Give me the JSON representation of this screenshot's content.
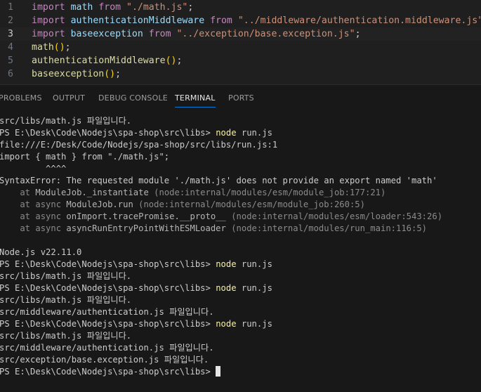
{
  "editor": {
    "lines": [
      {
        "num": "1",
        "parts": [
          {
            "t": "import",
            "c": "kw"
          },
          {
            "t": " ",
            "c": "pun"
          },
          {
            "t": "math",
            "c": "id"
          },
          {
            "t": " ",
            "c": "pun"
          },
          {
            "t": "from",
            "c": "kw"
          },
          {
            "t": " ",
            "c": "pun"
          },
          {
            "t": "\"./math.js\"",
            "c": "str"
          },
          {
            "t": ";",
            "c": "pun"
          }
        ]
      },
      {
        "num": "2",
        "parts": [
          {
            "t": "import",
            "c": "kw"
          },
          {
            "t": " ",
            "c": "pun"
          },
          {
            "t": "authenticationMiddleware",
            "c": "id"
          },
          {
            "t": " ",
            "c": "pun"
          },
          {
            "t": "from",
            "c": "kw"
          },
          {
            "t": " ",
            "c": "pun"
          },
          {
            "t": "\"../middleware/authentication.middleware.js\"",
            "c": "str"
          },
          {
            "t": ";",
            "c": "pun"
          }
        ]
      },
      {
        "num": "3",
        "parts": [
          {
            "t": "import",
            "c": "kw"
          },
          {
            "t": " ",
            "c": "pun"
          },
          {
            "t": "baseexception",
            "c": "id"
          },
          {
            "t": " ",
            "c": "pun"
          },
          {
            "t": "from",
            "c": "kw"
          },
          {
            "t": " ",
            "c": "pun"
          },
          {
            "t": "\"../exception/base.exception.js\"",
            "c": "str"
          },
          {
            "t": ";",
            "c": "pun"
          }
        ]
      },
      {
        "num": "4",
        "parts": [
          {
            "t": "math",
            "c": "fn"
          },
          {
            "t": "()",
            "c": "brk"
          },
          {
            "t": ";",
            "c": "pun"
          }
        ]
      },
      {
        "num": "5",
        "parts": [
          {
            "t": "authenticationMiddleware",
            "c": "fn"
          },
          {
            "t": "()",
            "c": "brk"
          },
          {
            "t": ";",
            "c": "pun"
          }
        ]
      },
      {
        "num": "6",
        "parts": [
          {
            "t": "baseexception",
            "c": "fn"
          },
          {
            "t": "()",
            "c": "brk"
          },
          {
            "t": ";",
            "c": "pun"
          }
        ]
      }
    ]
  },
  "panel": {
    "tabs": [
      {
        "label": "PROBLEMS",
        "active": false
      },
      {
        "label": "OUTPUT",
        "active": false
      },
      {
        "label": "DEBUG CONSOLE",
        "active": false
      },
      {
        "label": "TERMINAL",
        "active": true
      },
      {
        "label": "PORTS",
        "active": false
      }
    ]
  },
  "terminal": {
    "lines": [
      {
        "kind": "text",
        "text": "src/libs/math.js 파일입니다."
      },
      {
        "kind": "prompt",
        "prompt": "PS E:\\Desk\\Code\\Nodejs\\spa-shop\\src\\libs> ",
        "cmd": "node",
        "args": " run.js"
      },
      {
        "kind": "text",
        "text": "file:///E:/Desk/Code/Nodejs/spa-shop/src/libs/run.js:1"
      },
      {
        "kind": "text",
        "text": "import { math } from \"./math.js\";"
      },
      {
        "kind": "text",
        "text": "         ^^^^"
      },
      {
        "kind": "text",
        "text": "SyntaxError: The requested module './math.js' does not provide an export named 'math'"
      },
      {
        "kind": "stack",
        "pre": "    at ",
        "fn": "ModuleJob._instantiate",
        "loc": " (node:internal/modules/esm/module_job:177:21)"
      },
      {
        "kind": "stack",
        "pre": "    at async ",
        "fn": "ModuleJob.run",
        "loc": " (node:internal/modules/esm/module_job:260:5)"
      },
      {
        "kind": "stack",
        "pre": "    at async ",
        "fn": "onImport.tracePromise.__proto__",
        "loc": " (node:internal/modules/esm/loader:543:26)"
      },
      {
        "kind": "stack",
        "pre": "    at async ",
        "fn": "asyncRunEntryPointWithESMLoader",
        "loc": " (node:internal/modules/run_main:116:5)"
      },
      {
        "kind": "text",
        "text": ""
      },
      {
        "kind": "text",
        "text": "Node.js v22.11.0"
      },
      {
        "kind": "prompt",
        "prompt": "PS E:\\Desk\\Code\\Nodejs\\spa-shop\\src\\libs> ",
        "cmd": "node",
        "args": " run.js"
      },
      {
        "kind": "text",
        "text": "src/libs/math.js 파일입니다."
      },
      {
        "kind": "prompt",
        "prompt": "PS E:\\Desk\\Code\\Nodejs\\spa-shop\\src\\libs> ",
        "cmd": "node",
        "args": " run.js"
      },
      {
        "kind": "text",
        "text": "src/libs/math.js 파일입니다."
      },
      {
        "kind": "text",
        "text": "src/middleware/authentication.js 파일입니다."
      },
      {
        "kind": "prompt",
        "prompt": "PS E:\\Desk\\Code\\Nodejs\\spa-shop\\src\\libs> ",
        "cmd": "node",
        "args": " run.js"
      },
      {
        "kind": "text",
        "text": "src/libs/math.js 파일입니다."
      },
      {
        "kind": "text",
        "text": "src/middleware/authentication.js 파일입니다."
      },
      {
        "kind": "text",
        "text": "src/exception/base.exception.js 파일입니다."
      },
      {
        "kind": "cursor",
        "prompt": "PS E:\\Desk\\Code\\Nodejs\\spa-shop\\src\\libs> "
      }
    ]
  }
}
